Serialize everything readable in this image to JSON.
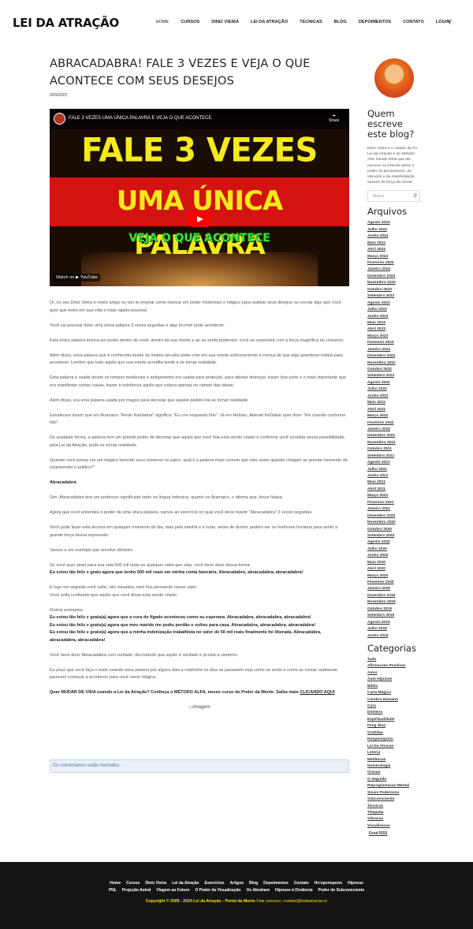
{
  "site": {
    "logo": "LEI DA ATRAÇÃO"
  },
  "nav": [
    "Home",
    "CURSOS",
    "DINIZ VIEIRA",
    "LEI DA ATRAÇÃO",
    "TECNICAS",
    "BLOG",
    "DEPOIMENTOS",
    "CONTATO",
    "LOGIN"
  ],
  "post": {
    "title": "ABRACADABRA! FALE 3 VEZES E VEJA O QUE ACONTECE COM SEUS DESEJOS",
    "date": "20/9/2022"
  },
  "video": {
    "title": "FALE 3 VEZES UMA ÚNICA PALAVRA E VEJA O QUE ACONTECE",
    "share": "Share",
    "line1": "FALE 3 VEZES",
    "line2": "UMA ÚNICA PALAVRA",
    "line3": "VEJA O QUE ACONTECE",
    "watch": "Watch on ▶ YouTube"
  },
  "content": {
    "p1": "Oi, eu sou Diniz Vieira e neste artigo eu vou te ensinar como invocar um poder misterioso e mágico para realizar seus desejos ou cocriar algo que você quer que entre em sua vida o mais rápido possível.",
    "p2": "Você vai precisar dizer uma única palavra 3 vezes seguidas e algo incrível pode acontecer.",
    "p3": "Esta única palavra invoca um poder dentro de você, dentro da sua mente e ao se sentir poderoso, você se conectará com a força magnífica do Universo.",
    "p4": "Além disso, essa palavra que é conhecida desde os muitos séculos pode criar em sua mente subconsciente a crença de que algo grandioso estará para acontecer. Lembre que tudo aquilo que sua mente acredita tende a se tornar realidade.",
    "p5": "Esta palavra é usada desde os tempos medievais e antigamente era usada para proteção, para afastar doenças, trazer boa sorte e o mais importante que era manifestar certas coisas, trazer à existência aquilo que estava apenas no campo das ideias.",
    "p6": "Além disso, era uma palavra usada por magos para decretar que aquele pedido iria se tornar realidade.",
    "p7": "Estudiosos dizem que em Aramaico \"Avrah Kahdabra\" significa: \"Eu crio enquanto falo\". Já em Hebreu, Aberah KeDabar quer dizer \"Irei criando conforme falo\".",
    "p8": "De qualquer forma, a palavra tem um grande poder de decretar que aquilo que você fala está sendo criado e conforme você acredita nessa possibilidade, pela Lei da Atração, pode se tornar realidade.",
    "p9": "Quando você pensa em um mágico fazendo seus números no palco, qual é a palavra mais comum que eles usam quando chegam ao grande momento de surpreender o público?",
    "h1": "Abracadabra",
    "p10": "Sim, Abracadabra tem um poderoso significado tanto na língua hebraica, quanto no Aramaico, o idioma que Jesus falava.",
    "p11": "Agora que você entendeu o poder de uma única palavra, vamos ao exercício no qual você deve repetir \"Abracadabra\" 3 vezes seguidas.",
    "p12": "Você pode fazer esta técnica em qualquer momento do dia, mas pela manhã e à noite, antes de dormir, podem ser os melhores horários para sentir a grande força dessa expressão.",
    "p13": "Vamos a um exemplo que envolve dinheiro.",
    "p14": "Se você quer atrair para sua vida 500 mil reais ou qualquer valor que seja, você deve dizer dessa forma:",
    "p14b": "Eu estou tão feliz e grato agora que tenho 500 mil reais em minha conta bancária. Abracadabra, abracadabra, abracadabra!",
    "p15": "E logo em seguida você solta, não visualiza, nem fica pensando nesse valor.",
    "p15b": "Você solta confiando que aquilo que você disse está sendo criado.",
    "p16": "Outros exemplos:",
    "ex1": "Eu estou tão feliz e grato(a) agora que a cura do fígado aconteceu como eu esperava. Abracadabra, abracadabra, abracadabra!",
    "ex2": "Eu estou tão feliz e grato(a) agora que meu marido me pediu perdão e voltou para casa. Abracadabra, abracadabra, abracadabra!",
    "ex3": "Eu estou tão feliz e grato(a) agora que a minha indenização trabalhista no valor de 50 mil reais finalmente foi liberada. Abracadabra, abracadabra, abracadabra!",
    "p17": "Você deve dizer Abracadabra com vontade, decretando que aquilo é verdade e já está a caminho.",
    "p18": "Eu peço que você faça o teste usando essa palavra por alguns dias e conforme os dias se passarem veja como se sente e como as coisas realmente parecem começar a acontecer para você como mágica.",
    "cta": "Quer MUDAR DE VIDA usando a Lei da Atração? Conheça o MÉTODO ALFA, nosso curso do Poder da Mente. Saiba mais ",
    "cta_link": "CLICANDO AQUI",
    "img_alt": "Imagem",
    "comments": "Os comentários estão fechados."
  },
  "sidebar": {
    "who": "Quem escreve este blog?",
    "bio": "Diniz Vieira é o criador da TV Lei da Atração e do Método Alfa. Desde 2009 que ele escreve na internet sobre o poder do pensamento, da vibração e da manifestação através da força da mente.",
    "search_placeholder": "Busca",
    "archives_title": "Arquivos",
    "archives": [
      "Agosto 2024",
      "Julho 2024",
      "Junho 2024",
      "Maio 2024",
      "Abril 2024",
      "Março 2024",
      "Fevereiro 2024",
      "Janeiro 2024",
      "Dezembro 2023",
      "Novembro 2023",
      "Outubro 2023",
      "Setembro 2023",
      "Agosto 2023",
      "Julho 2023",
      "Junho 2023",
      "Maio 2023",
      "Abril 2023",
      "Março 2023",
      "Fevereiro 2023",
      "Janeiro 2023",
      "Dezembro 2022",
      "Novembro 2022",
      "Outubro 2022",
      "Setembro 2022",
      "Agosto 2022",
      "Julho 2022",
      "Junho 2022",
      "Maio 2022",
      "Abril 2022",
      "Março 2022",
      "Fevereiro 2022",
      "Janeiro 2022",
      "Dezembro 2021",
      "Novembro 2021",
      "Outubro 2021",
      "Setembro 2021",
      "Agosto 2021",
      "Julho 2021",
      "Junho 2021",
      "Maio 2021",
      "Abril 2021",
      "Março 2021",
      "Fevereiro 2021",
      "Janeiro 2021",
      "Dezembro 2020",
      "Novembro 2020",
      "Outubro 2020",
      "Setembro 2020",
      "Agosto 2020",
      "Julho 2020",
      "Junho 2020",
      "Maio 2020",
      "Abril 2020",
      "Março 2020",
      "Fevereiro 2020",
      "Janeiro 2020",
      "Dezembro 2019",
      "Novembro 2019",
      "Outubro 2019",
      "Setembro 2019",
      "Agosto 2019",
      "Julho 2019",
      "Junho 2019"
    ],
    "categories_title": "Categorias",
    "categories": [
      "Tudo",
      "Afirmacoes Positivas",
      "Amor",
      "Auto Hipnose",
      "Bíblia",
      "Carta Mágica",
      "Cerebro Humano",
      "Cura",
      "Dinheiro",
      "Espiritualidade",
      "Feng Shui",
      "Gratidao",
      "Hooponopono",
      "Lei Da Atracao",
      "Loteria",
      "Meditacao",
      "Numerologia",
      "Oracao",
      "O Segredo",
      "Reprogramacao Mental",
      "Sinais Poderosos",
      "Subconsciente",
      "Tecnicas",
      "Telepatia",
      "Vibracao",
      "Visualizacao"
    ],
    "feed": "Feed RSS"
  },
  "footer": {
    "row1": [
      "Home",
      "Cursos",
      "Diniz Vieira",
      "Lei da Atração",
      "Exercícios",
      "Artigos",
      "Blog",
      "Depoimentos",
      "Contato",
      "Ho'oponopono",
      "Hipnose"
    ],
    "row2": [
      "PNL",
      "Projeção Astral",
      "Viagem ao Futuro",
      "O Poder da Visualização",
      "Os Abraham",
      "Hipnose à Distância",
      "Poder do Subconsciente"
    ],
    "copyright": "Copyright © 2009 - 2024 Lei da Atração - Portal da Mente ",
    "contact": "Fale conosco: contato@leidaatracao.tv"
  }
}
